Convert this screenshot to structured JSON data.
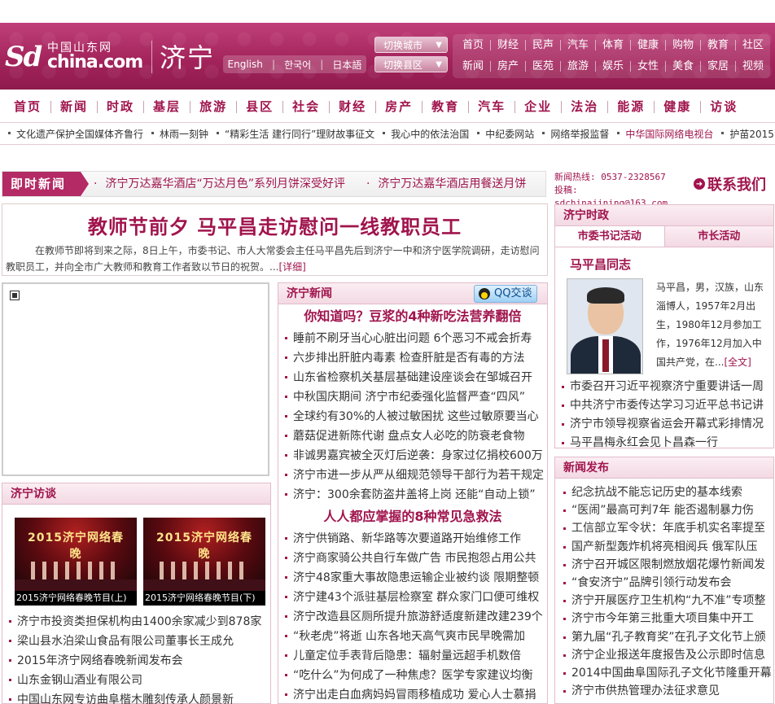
{
  "header": {
    "logo": {
      "sd": "Sd",
      "cn": "中国山东网",
      "china": "china.com"
    },
    "city_name": "济宁",
    "languages": [
      "English",
      "한국어",
      "日本語"
    ],
    "switch_city": "切换城市",
    "switch_county": "切换县区",
    "top_nav_row1": [
      "首页",
      "财经",
      "民声",
      "汽车",
      "体育",
      "健康",
      "购物",
      "教育",
      "社区"
    ],
    "top_nav_row2": [
      "新闻",
      "房产",
      "医苑",
      "旅游",
      "娱乐",
      "女性",
      "美食",
      "家居",
      "视频"
    ]
  },
  "main_nav": [
    "首页",
    "新闻",
    "时政",
    "基层",
    "旅游",
    "县区",
    "社会",
    "财经",
    "房产",
    "教育",
    "汽车",
    "企业",
    "法治",
    "能源",
    "健康",
    "访谈"
  ],
  "sub_nav": [
    {
      "label": "文化遗产保护全国媒体齐鲁行",
      "highlight": false
    },
    {
      "label": "林雨一刻钟",
      "highlight": false
    },
    {
      "label": "“精彩生活 建行同行”理财故事征文",
      "highlight": false
    },
    {
      "label": "我心中的依法治国",
      "highlight": false
    },
    {
      "label": "中纪委网站",
      "highlight": false
    },
    {
      "label": "网络举报监督",
      "highlight": false
    },
    {
      "label": "中华国际网络电视台",
      "highlight": true
    },
    {
      "label": "护苗2015",
      "highlight": false
    }
  ],
  "breaking": {
    "tag": "即时新闻",
    "items": [
      "济宁万达嘉华酒店“万达月色”系列月饼深受好评",
      "济宁万达嘉华酒店用餐送月饼"
    ]
  },
  "hotline": {
    "phone": "新闻热线: 0537-2328567",
    "email": "投稿: sdchinajining@163.com"
  },
  "contact_label": "联系我们",
  "headline": {
    "title": "教师节前夕 马平昌走访慰问一线教职员工",
    "summary": "在教师节即将到来之际，8日上午，市委书记、市人大常委会主任马平昌先后到济宁一中和济宁医学院调研，走访慰问教职员工，并向全市广大教师和教育工作者致以节日的祝贺。...",
    "more": "[详细]"
  },
  "interviews": {
    "title": "济宁访谈",
    "thumbs": [
      {
        "banner": "2015济宁网络春晚",
        "caption": "2015济宁网络春晚节目(上)"
      },
      {
        "banner": "2015济宁网络春晚",
        "caption": "2015济宁网络春晚节目(下)"
      }
    ],
    "items": [
      "济宁市投资类担保机构由1400余家减少到878家",
      "梁山县水泊梁山食品有限公司董事长王成允",
      "2015年济宁网络春晚新闻发布会",
      "山东金钢山酒业有限公司",
      "中国山东网专访曲阜楷木雕刻传承人颜景新"
    ]
  },
  "jining_news": {
    "title": "济宁新闻",
    "qq_label": "QQ交谈",
    "feature1": "你知道吗？豆浆的4种新吃法营养翻倍",
    "list1": [
      "睡前不刷牙当心心脏出问题 6个恶习不戒会折寿",
      "六步排出肝脏内毒素 检查肝脏是否有毒的方法",
      "山东省检察机关基层基础建设座谈会在邹城召开",
      "中秋国庆期间 济宁市纪委强化监督严查“四风”",
      "全球约有30%的人被过敏困扰 这些过敏原要当心",
      "蘑菇促进新陈代谢 盘点女人必吃的防衰老食物",
      "非诚男嘉宾被全灭灯后逆袭：身家过亿捐校600万",
      "济宁市进一步从严从细规范领导干部行为若干规定",
      "济宁：300余套防盗井盖将上岗 还能“自动上锁”"
    ],
    "feature2": "人人都应掌握的8种常见急救法",
    "list2": [
      "济宁供销路、新华路等次要道路开始维修工作",
      "济宁商家骑公共自行车做广告 市民抱怨占用公共",
      "济宁48家重大事故隐患运输企业被约谈 限期整顿",
      "济宁建43个派驻基层检察室 群众家门口便可维权",
      "济宁改造县区厕所提升旅游舒适度新建改建239个",
      "“秋老虎”将逝 山东各地天高气爽市民早晚需加",
      "儿童定位手表背后隐患：辐射量远超手机数倍",
      "“吃什么”为何成了一种焦虑？医学专家建议均衡",
      "济宁出走白血病妈妈冒雨移植成功 爱心人士慕捐"
    ]
  },
  "politics": {
    "title": "济宁时政",
    "tabs": [
      "市委书记活动",
      "市长活动"
    ],
    "name": "马平昌同志",
    "bio": "马平昌，男，汉族，山东淄博人，1957年2月出生，1980年12月参加工作，1976年12月加入中国共产党，在...",
    "more": "[全文]",
    "items": [
      "市委召开习近平视察济宁重要讲话一周",
      "中共济宁市委传达学习习近平总书记讲",
      "济宁市领导视察省运会开幕式彩排情况",
      "马平昌梅永红会见卜昌森一行"
    ]
  },
  "release": {
    "title": "新闻发布",
    "items": [
      "纪念抗战不能忘记历史的基本线索",
      "“医闹”最高可判7年 能否遏制暴力伤",
      "工信部立军令状：年底手机实名率提至",
      "国产新型轰炸机将亮相阅兵 俄军队压",
      "济宁召开城区限制燃放烟花爆竹新闻发",
      "“食安济宁”品牌引领行动发布会",
      "济宁开展医疗卫生机构“九不准”专项整",
      "济宁市今年第三批重大项目集中开工",
      "第九届“孔子教育奖”在孔子文化节上颁",
      "济宁企业报送年度报告及公示即时信息",
      "2014中国曲阜国际孔子文化节隆重开幕",
      "济宁市供热管理办法征求意见"
    ]
  },
  "colors": {
    "brand": "#a0144d",
    "banner_top": "#c0407a",
    "banner_bottom": "#8e1a4c"
  }
}
